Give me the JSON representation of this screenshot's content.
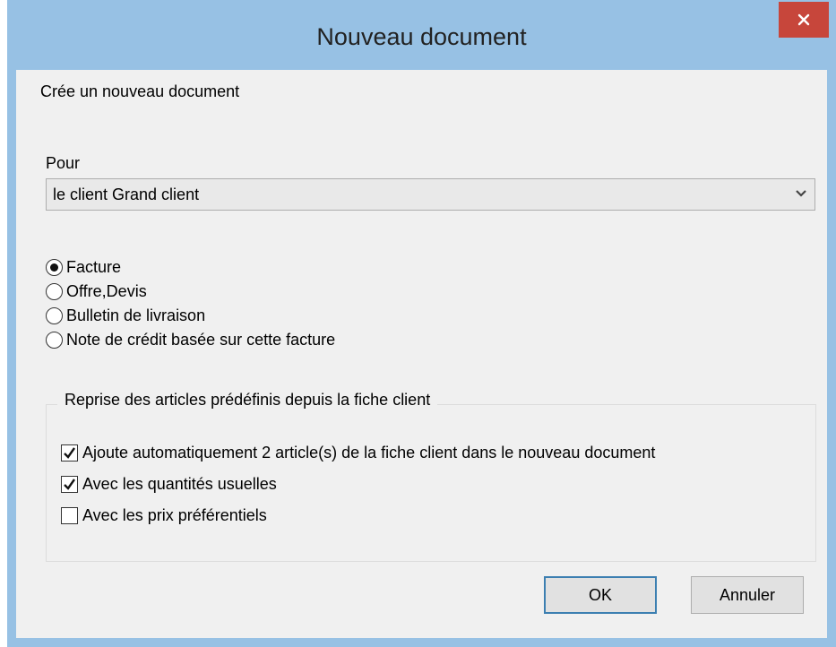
{
  "dialog": {
    "title": "Nouveau document",
    "close_icon": "close-icon",
    "description": "Crée un nouveau document",
    "for_label": "Pour",
    "recipient_selected": "le client Grand client",
    "document_types": [
      {
        "label": "Facture",
        "checked": true
      },
      {
        "label": "Offre,Devis",
        "checked": false
      },
      {
        "label": "Bulletin de livraison",
        "checked": false
      },
      {
        "label": "Note de crédit basée sur cette facture",
        "checked": false
      }
    ],
    "group": {
      "legend": "Reprise des articles prédéfinis depuis la fiche client",
      "options": [
        {
          "label": "Ajoute automatiquement 2 article(s) de la fiche client dans le nouveau document",
          "checked": true
        },
        {
          "label": "Avec les quantités usuelles",
          "checked": true
        },
        {
          "label": "Avec les prix préférentiels",
          "checked": false
        }
      ]
    },
    "ok_label": "OK",
    "cancel_label": "Annuler"
  },
  "colors": {
    "frame": "#97c1e4",
    "close": "#c7463b",
    "client": "#f0f0f0"
  }
}
